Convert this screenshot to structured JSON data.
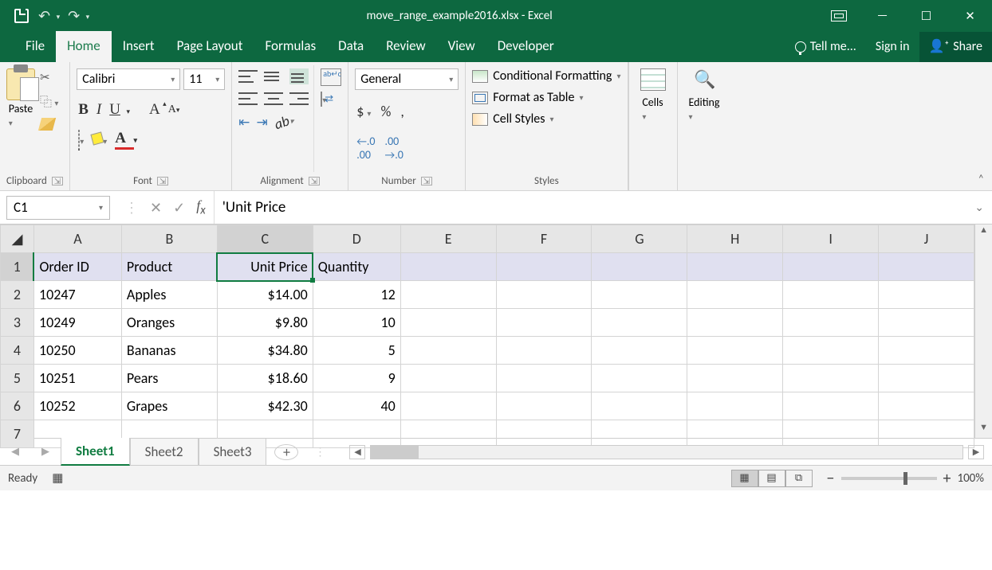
{
  "title": "move_range_example2016.xlsx - Excel",
  "tabs": {
    "file": "File",
    "home": "Home",
    "insert": "Insert",
    "pagelayout": "Page Layout",
    "formulas": "Formulas",
    "data": "Data",
    "review": "Review",
    "view": "View",
    "developer": "Developer",
    "tell": "Tell me...",
    "signin": "Sign in",
    "share": "Share"
  },
  "ribbon": {
    "clipboard": {
      "paste": "Paste",
      "label": "Clipboard"
    },
    "font": {
      "name": "Calibri",
      "size": "11",
      "label": "Font"
    },
    "alignment": {
      "label": "Alignment"
    },
    "number": {
      "format": "General",
      "label": "Number"
    },
    "styles": {
      "cond": "Conditional Formatting",
      "table": "Format as Table",
      "cell": "Cell Styles",
      "label": "Styles"
    },
    "cells": {
      "label": "Cells"
    },
    "editing": {
      "label": "Editing"
    }
  },
  "namebox": "C1",
  "formula": "'Unit Price",
  "columns": [
    "A",
    "B",
    "C",
    "D",
    "E",
    "F",
    "G",
    "H",
    "I",
    "J"
  ],
  "headers": {
    "a": "Order ID",
    "b": "Product",
    "c": "Unit Price",
    "d": "Quantity"
  },
  "rows": [
    {
      "a": "10247",
      "b": "Apples",
      "c": "$14.00",
      "d": "12"
    },
    {
      "a": "10249",
      "b": "Oranges",
      "c": "$9.80",
      "d": "10"
    },
    {
      "a": "10250",
      "b": "Bananas",
      "c": "$34.80",
      "d": "5"
    },
    {
      "a": "10251",
      "b": "Pears",
      "c": "$18.60",
      "d": "9"
    },
    {
      "a": "10252",
      "b": "Grapes",
      "c": "$42.30",
      "d": "40"
    }
  ],
  "sheets": {
    "s1": "Sheet1",
    "s2": "Sheet2",
    "s3": "Sheet3"
  },
  "status": {
    "ready": "Ready",
    "zoom": "100%"
  }
}
